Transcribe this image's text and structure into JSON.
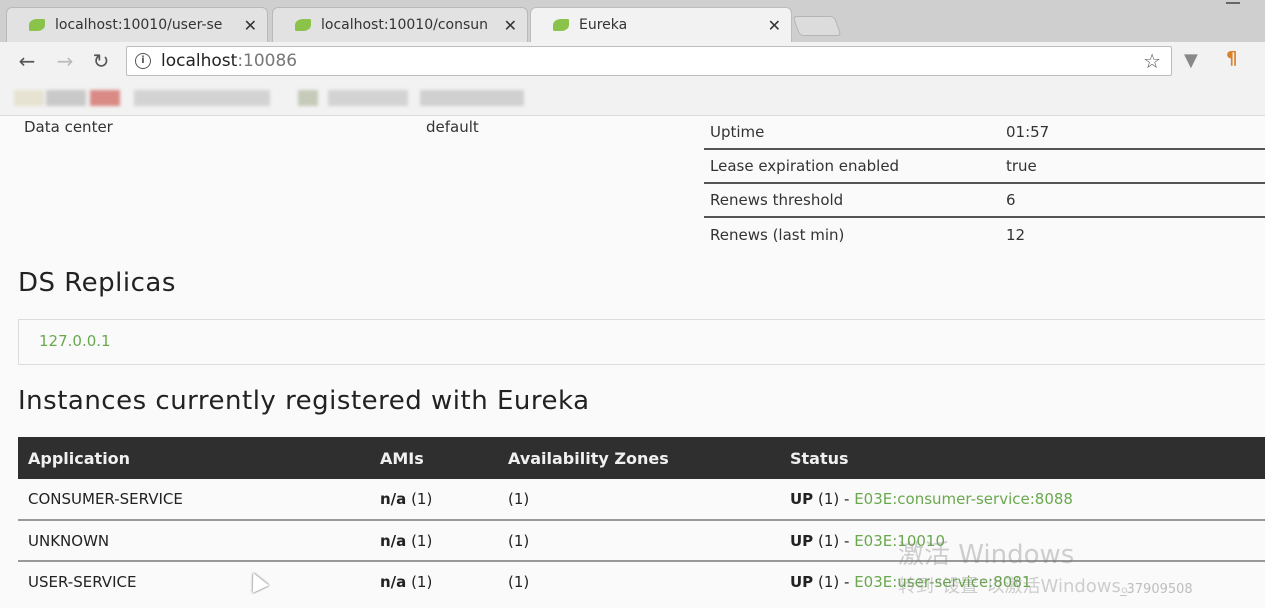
{
  "browser": {
    "tabs": [
      {
        "label": "localhost:10010/user-se",
        "close": "✕"
      },
      {
        "label": "localhost:10010/consun",
        "close": "✕"
      },
      {
        "label": "Eureka",
        "close": "✕"
      }
    ],
    "address": {
      "host": "localhost",
      "port": ":10086"
    }
  },
  "general_info": {
    "data_center_label": "Data center",
    "data_center_value": "default",
    "stats": [
      {
        "key": "Uptime",
        "value": "01:57"
      },
      {
        "key": "Lease expiration enabled",
        "value": "true"
      },
      {
        "key": "Renews threshold",
        "value": "6"
      },
      {
        "key": "Renews (last min)",
        "value": "12"
      }
    ]
  },
  "ds_replicas": {
    "title": "DS Replicas",
    "items": [
      "127.0.0.1"
    ]
  },
  "instances": {
    "title": "Instances currently registered with Eureka",
    "headers": [
      "Application",
      "AMIs",
      "Availability Zones",
      "Status"
    ],
    "rows": [
      {
        "app": "CONSUMER-SERVICE",
        "ami": "n/a",
        "ami_count": "(1)",
        "zones": "(1)",
        "status": "UP",
        "status_count": "(1) -",
        "instance": "E03E:consumer-service:8088"
      },
      {
        "app": "UNKNOWN",
        "ami": "n/a",
        "ami_count": "(1)",
        "zones": "(1)",
        "status": "UP",
        "status_count": "(1) -",
        "instance": "E03E:10010"
      },
      {
        "app": "USER-SERVICE",
        "ami": "n/a",
        "ami_count": "(1)",
        "zones": "(1)",
        "status": "UP",
        "status_count": "(1) -",
        "instance": "E03E:user-service:8081"
      }
    ]
  },
  "watermark": {
    "line1": "激活 Windows",
    "line2": "转到\"设置\"以激活Windows。",
    "credit": "_37909508"
  },
  "colors": {
    "link": "#6aa84f",
    "table_header": "#2f2f2f",
    "favicon": "#8bc34a"
  }
}
